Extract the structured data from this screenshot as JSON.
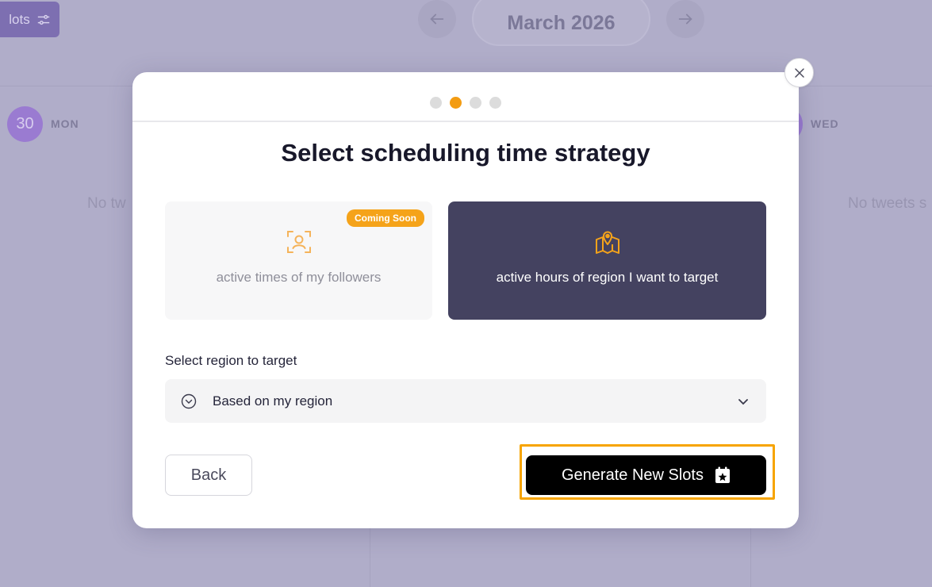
{
  "background": {
    "slots_label": "lots",
    "month": "March 2026",
    "days": [
      {
        "number": "30",
        "name": "MON"
      },
      {
        "name": "WED"
      }
    ],
    "empty_left": "No tw",
    "empty_right": "No tweets s"
  },
  "modal": {
    "steps": [
      false,
      true,
      false,
      false
    ],
    "title": "Select scheduling time strategy",
    "options": [
      {
        "label": "active times of my followers",
        "badge": "Coming Soon",
        "icon": "user-focus-icon",
        "selected": false
      },
      {
        "label": "active hours of region I want to target",
        "icon": "map-pin-icon",
        "selected": true
      }
    ],
    "region_label": "Select region to target",
    "region_value": "Based on my region",
    "back_label": "Back",
    "generate_label": "Generate New Slots"
  },
  "colors": {
    "accent": "#f39c12",
    "selected_option": "#444260",
    "overlay": "#b0adc9"
  }
}
